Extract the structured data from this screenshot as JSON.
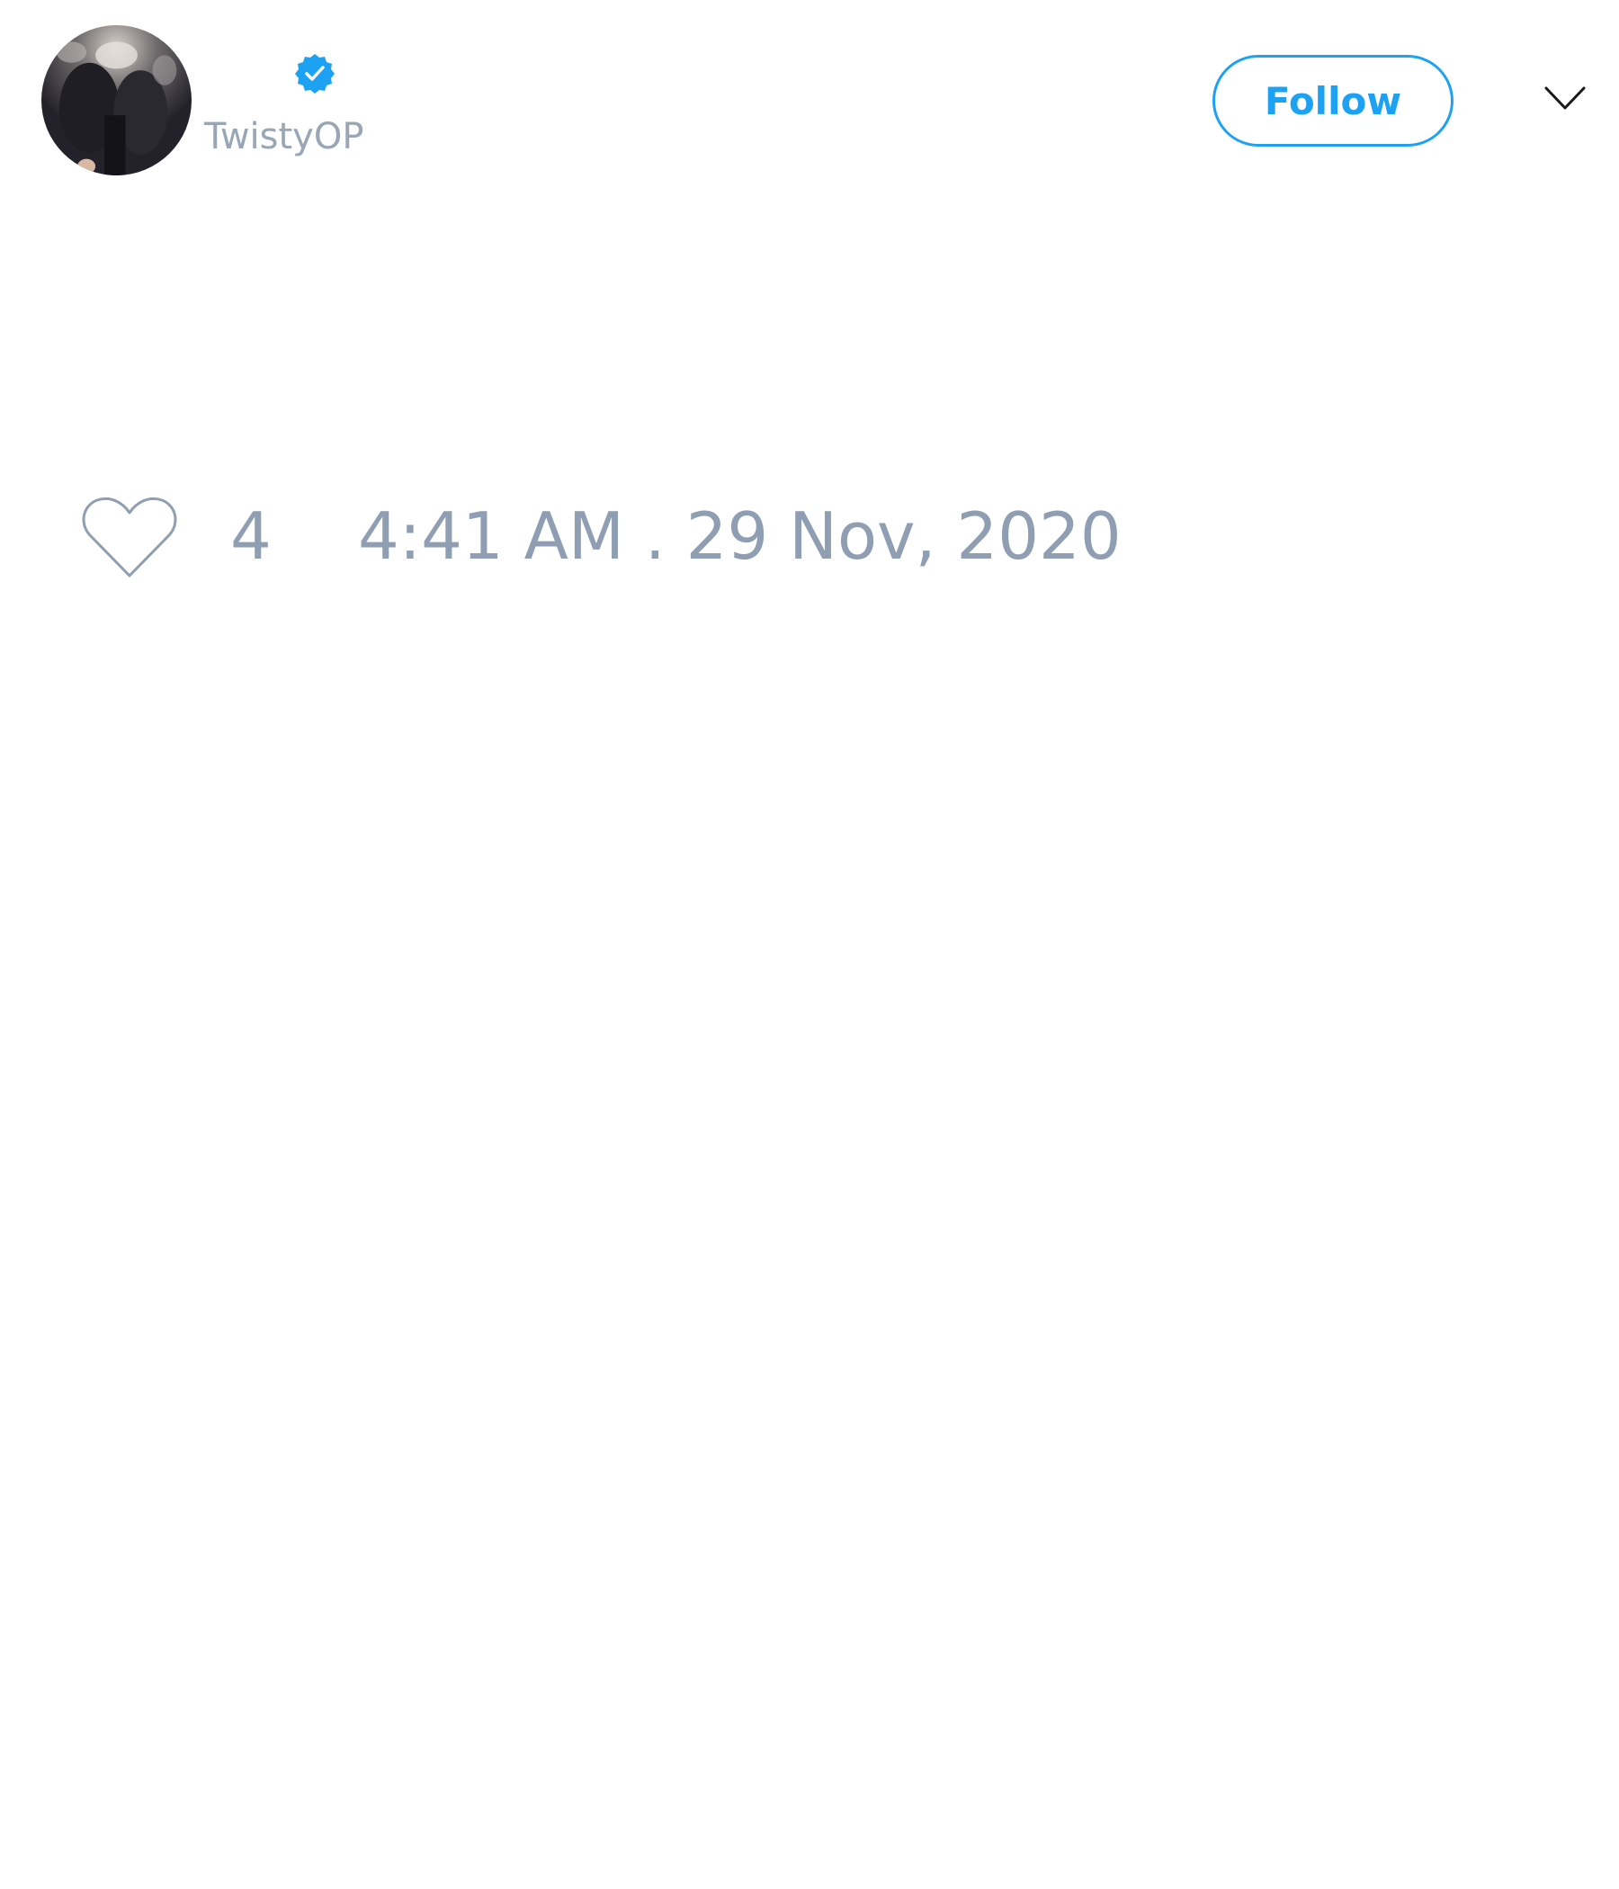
{
  "tweet": {
    "author": {
      "handle": "TwistyOP",
      "avatar_icon": "avatar-photo",
      "verified_icon": "verified-badge-icon"
    },
    "follow_button": {
      "label": "Follow"
    },
    "menu_icon": "chevron-down-icon",
    "likes": {
      "icon": "heart-icon",
      "count": "4"
    },
    "timestamp": "4:41 AM . 29 Nov, 2020"
  },
  "colors": {
    "accent": "#1da1f2",
    "muted_text": "#8f9eb2",
    "background": "#ffffff"
  }
}
